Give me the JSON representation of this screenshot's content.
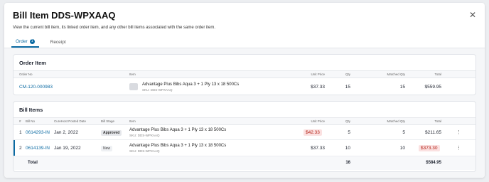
{
  "dialog": {
    "title": "Bill Item DDS-WPXAAQ",
    "close_glyph": "✕",
    "description": "View the current bill item, its linked order item, and any other bill items associated with the same order item."
  },
  "tabs": [
    {
      "label": "Order",
      "badge": "1",
      "active": true
    },
    {
      "label": "Receipt",
      "active": false
    }
  ],
  "order_item": {
    "title": "Order Item",
    "columns": {
      "order_no": "Order No",
      "item": "Item",
      "unit_price": "Unit Price",
      "qty": "Qty",
      "matched_qty": "Matched Qty",
      "total": "Total"
    },
    "row": {
      "order_no": "CM-120-000983",
      "item_name": "Advantage Plus Bibs Aqua 3 + 1 Ply 13 x 18 500Cs",
      "sku": "SKU: DDS-WPXAAQ",
      "unit_price": "$37.33",
      "qty": "15",
      "matched_qty": "15",
      "total": "$559.95"
    }
  },
  "bill_items": {
    "title": "Bill Items",
    "columns": {
      "num": "#",
      "bill_no": "Bill No",
      "posted_date": "CureHost Posted Date",
      "stage": "Bill Stage",
      "item": "Item",
      "unit_price": "Unit Price",
      "qty": "Qty",
      "matched_qty": "Matched Qty",
      "total": "Total"
    },
    "rows": [
      {
        "num": "1",
        "bill_no": "0614293-IN",
        "posted_date": "Jan 2, 2022",
        "stage": "Approved",
        "item_name": "Advantage Plus Bibs Aqua 3 + 1 Ply 13 x 18 500Cs",
        "sku": "SKU: DDS-WPXAAQ",
        "unit_price": "$42.33",
        "qty": "5",
        "matched_qty": "5",
        "total": "$211.65"
      },
      {
        "num": "2",
        "bill_no": "0614139-IN",
        "posted_date": "Jan 19, 2022",
        "stage": "New",
        "item_name": "Advantage Plus Bibs Aqua 3 + 1 Ply 13 x 18 500Cs",
        "sku": "SKU: DDS-WPXAAQ",
        "unit_price": "$37.33",
        "qty": "10",
        "matched_qty": "10",
        "total": "$373.30"
      }
    ],
    "totals": {
      "label": "Total",
      "qty": "16",
      "total": "$584.95"
    },
    "kebab_glyph": "⋮"
  },
  "colors": {
    "accent": "#0b6aa2",
    "warning_bg": "#fbe1e1",
    "warning_text": "#b42318"
  }
}
